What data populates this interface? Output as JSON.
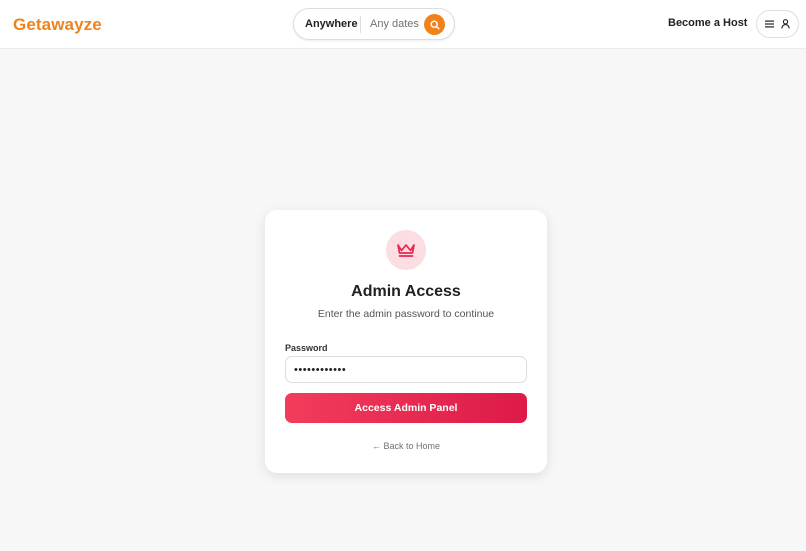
{
  "header": {
    "logo": "Getawayze",
    "search": {
      "location": "Anywhere",
      "dates": "Any dates",
      "search_icon": "search-icon"
    },
    "host_link": "Become a Host",
    "user_menu": {
      "menu_icon": "hamburger-menu-icon",
      "user_icon": "user-icon"
    }
  },
  "login": {
    "icon": "crown-icon",
    "title": "Admin Access",
    "subtitle": "Enter the admin password to continue",
    "password_label": "Password",
    "password_value": "••••••••••••",
    "submit_label": "Access Admin Panel",
    "back_link": "← Back to Home"
  },
  "colors": {
    "brand": "#f0821e",
    "accent": "#e8264f",
    "icon_bg": "#fbdde2",
    "page_bg": "#f7f7f7"
  }
}
